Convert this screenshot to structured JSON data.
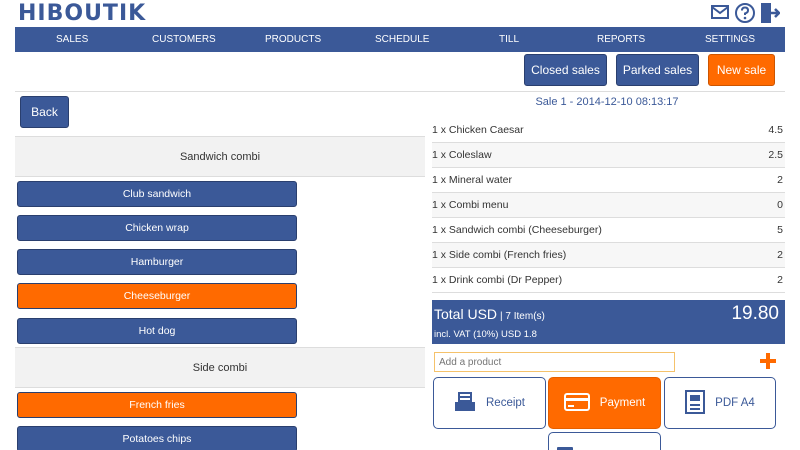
{
  "app": {
    "logo": "HIBOUTIK"
  },
  "header_icons": [
    "mail-icon",
    "help-icon",
    "logout-icon"
  ],
  "nav": [
    "SALES",
    "CUSTOMERS",
    "PRODUCTS",
    "SCHEDULE",
    "TILL",
    "REPORTS",
    "SETTINGS"
  ],
  "top_buttons": {
    "closed": "Closed sales",
    "parked": "Parked sales",
    "new": "New sale"
  },
  "left": {
    "back": "Back",
    "sections": [
      {
        "title": "Sandwich combi"
      },
      {
        "title": "Side combi"
      }
    ],
    "sandwich_items": [
      {
        "label": "Club sandwich",
        "selected": false
      },
      {
        "label": "Chicken wrap",
        "selected": false
      },
      {
        "label": "Hamburger",
        "selected": false
      },
      {
        "label": "Cheeseburger",
        "selected": true
      },
      {
        "label": "Hot dog",
        "selected": false
      }
    ],
    "side_items": [
      {
        "label": "French fries",
        "selected": true
      },
      {
        "label": "Potatoes chips",
        "selected": false
      }
    ]
  },
  "sale": {
    "title": "Sale 1 - 2014-12-10 08:13:17",
    "lines": [
      {
        "desc": "1 x Chicken Caesar",
        "price": "4.5"
      },
      {
        "desc": "1 x Coleslaw",
        "price": "2.5"
      },
      {
        "desc": "1 x Mineral water",
        "price": "2"
      },
      {
        "desc": "1 x Combi menu",
        "price": "0"
      },
      {
        "desc": "1 x Sandwich combi (Cheeseburger)",
        "price": "5"
      },
      {
        "desc": "1 x Side combi (French fries)",
        "price": "2"
      },
      {
        "desc": "1 x Drink combi (Dr Pepper)",
        "price": "2"
      }
    ],
    "total_label": "Total USD",
    "items_count": "| 7 Item(s)",
    "vat": "incl. VAT (10%) USD 1.8",
    "total": "19.80",
    "add_placeholder": "Add a product"
  },
  "actions": {
    "receipt": "Receipt",
    "payment": "Payment",
    "pdf": "PDF A4"
  },
  "colors": {
    "brand": "#3b5998",
    "accent": "#ff6a00"
  }
}
